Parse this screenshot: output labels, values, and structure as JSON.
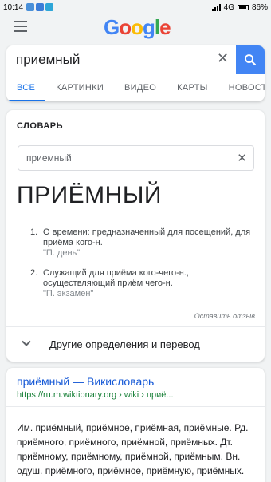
{
  "status_bar": {
    "time": "10:14",
    "network": "4G",
    "battery": "86%"
  },
  "header": {
    "logo_letters": [
      "G",
      "o",
      "o",
      "g",
      "l",
      "e"
    ]
  },
  "search": {
    "query": "приемный"
  },
  "tabs": [
    {
      "label": "ВСЕ",
      "active": true
    },
    {
      "label": "КАРТИНКИ",
      "active": false
    },
    {
      "label": "ВИДЕО",
      "active": false
    },
    {
      "label": "КАРТЫ",
      "active": false
    },
    {
      "label": "НОВОСТИ",
      "active": false
    }
  ],
  "dictionary": {
    "heading": "СЛОВАРЬ",
    "input_value": "приемный",
    "headword": "ПРИЁМНЫЙ",
    "definitions": [
      {
        "num": "1.",
        "text": "О времени: предназначенный для посещений, для приёма кого-н.",
        "example": "\"П. день\""
      },
      {
        "num": "2.",
        "text": "Служащий для приёма кого-чего-н., осуществляющий приём чего-н.",
        "example": "\"П. экзамен\""
      }
    ],
    "feedback": "Оставить отзыв",
    "more": "Другие определения и перевод"
  },
  "result": {
    "title": "приёмный — Викисловарь",
    "url": "https://ru.m.wiktionary.org › wiki › приё...",
    "snippet": "Им. приёмный, приёмное, приёмная, приёмные. Рд. приёмного, приёмного, приёмной, приёмных. Дт. приёмному, приёмному, приёмной, приёмным. Вн. одуш. приёмного, приёмное, приёмную, приёмных."
  },
  "colors": {
    "accent": "#1a73e8",
    "search_button": "#4285f4",
    "url_green": "#188038"
  }
}
